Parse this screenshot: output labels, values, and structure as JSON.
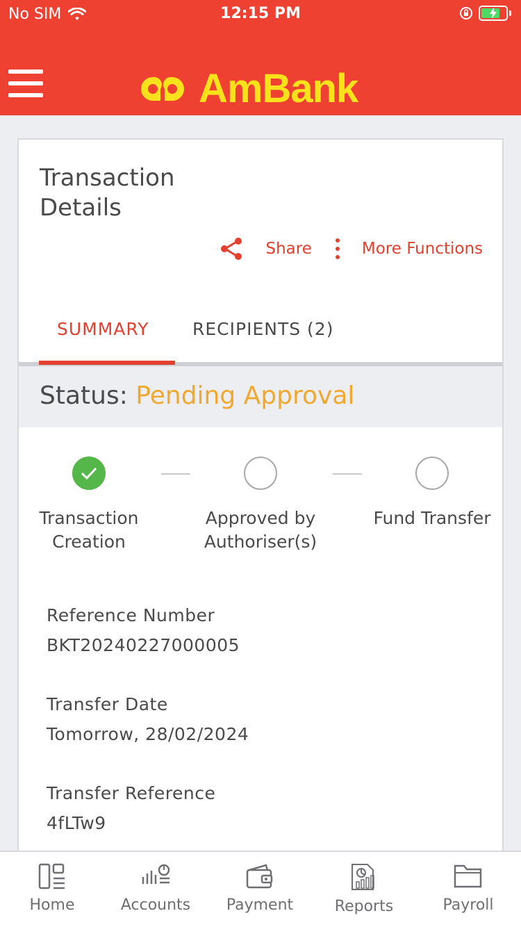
{
  "status_bar": {
    "carrier": "No SIM",
    "time": "12:15 PM"
  },
  "header": {
    "brand": "AmBank",
    "colors": {
      "bar": "#ee4132",
      "logo": "#f9e21b"
    }
  },
  "page": {
    "title": "Transaction Details",
    "actions": {
      "share": "Share",
      "more": "More Functions"
    },
    "tabs": [
      {
        "label": "SUMMARY",
        "active": true
      },
      {
        "label": "RECIPIENTS (2)",
        "active": false
      }
    ],
    "status": {
      "label": "Status:",
      "value": "Pending Approval",
      "value_color": "#f0a830"
    },
    "steps": [
      {
        "label": "Transaction Creation",
        "done": true
      },
      {
        "label": "Approved by Authoriser(s)",
        "done": false
      },
      {
        "label": "Fund Transfer",
        "done": false
      }
    ],
    "fields": [
      {
        "label": "Reference Number",
        "value": "BKT20240227000005"
      },
      {
        "label": "Transfer Date",
        "value": "Tomorrow, 28/02/2024"
      },
      {
        "label": "Transfer Reference",
        "value": "4fLTw9"
      }
    ]
  },
  "bottom_nav": {
    "items": [
      {
        "label": "Home",
        "icon": "home-icon"
      },
      {
        "label": "Accounts",
        "icon": "accounts-icon"
      },
      {
        "label": "Payment",
        "icon": "wallet-icon"
      },
      {
        "label": "Reports",
        "icon": "reports-icon"
      },
      {
        "label": "Payroll",
        "icon": "folder-icon"
      }
    ]
  }
}
